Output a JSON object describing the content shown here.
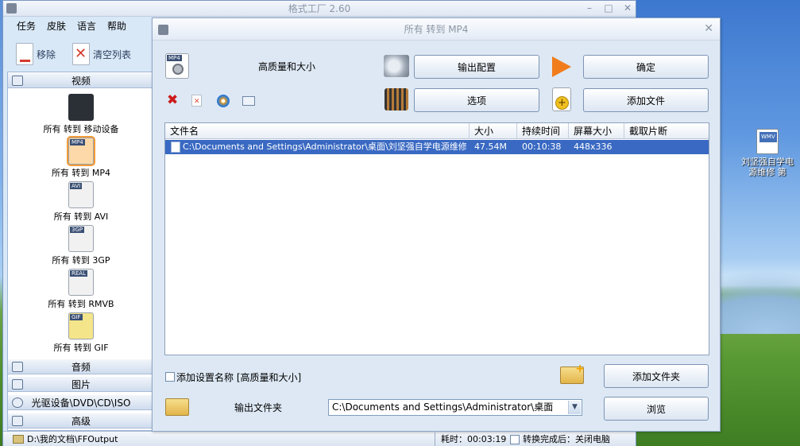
{
  "app": {
    "title": "格式工厂 2.60",
    "menu": [
      "任务",
      "皮肤",
      "语言",
      "帮助"
    ],
    "toolbar": {
      "remove_label": "移除",
      "clear_label": "清空列表"
    },
    "categories": {
      "video": "视频",
      "audio": "音频",
      "image": "图片",
      "disc": "光驱设备\\DVD\\CD\\ISO",
      "advanced": "高级"
    },
    "video_items": [
      {
        "label": "所有 转到 移动设备",
        "fmt": ""
      },
      {
        "label": "所有 转到 MP4",
        "fmt": "MP4"
      },
      {
        "label": "所有 转到 AVI",
        "fmt": "AVI"
      },
      {
        "label": "所有 转到 3GP",
        "fmt": "3GP"
      },
      {
        "label": "所有 转到 RMVB",
        "fmt": "REAL"
      },
      {
        "label": "所有 转到 GIF",
        "fmt": "GIF"
      }
    ],
    "status": {
      "output_path": "D:\\我的文档\\FFOutput",
      "elapsed_label": "耗时：00:03:19",
      "after_done_label": "转换完成后：关闭电脑"
    }
  },
  "dialog": {
    "title": "所有 转到 MP4",
    "preset_label": "高质量和大小",
    "mp4_badge": "MP4",
    "buttons": {
      "output_config": "输出配置",
      "ok": "确定",
      "options": "选项",
      "add_file": "添加文件",
      "add_folder": "添加文件夹",
      "browse": "浏览"
    },
    "table": {
      "columns": [
        "文件名",
        "大小",
        "持续时间",
        "屏幕大小",
        "截取片断"
      ],
      "rows": [
        {
          "filename": "C:\\Documents and Settings\\Administrator\\桌面\\刘坚强自学电源维修 ...",
          "size": "47.54M",
          "duration": "00:10:38",
          "screen": "448x336",
          "clip": ""
        }
      ]
    },
    "add_setting_name_label": "添加设置名称 [高质量和大小]",
    "output_folder_label": "输出文件夹",
    "output_folder_value": "C:\\Documents and Settings\\Administrator\\桌面"
  },
  "desktop": {
    "file_icon_label": "刘坚强自学电源维修 第",
    "file_icon_tag": "WMV"
  }
}
